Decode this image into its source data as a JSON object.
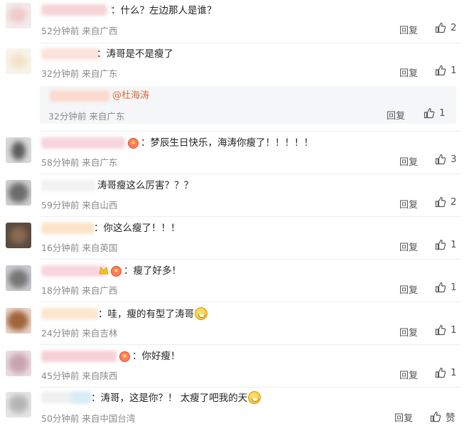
{
  "comments": [
    {
      "text": "：什么？左边那人是谁？",
      "time": "52分钟前",
      "location": "来自广西",
      "reply": "回复",
      "likes": "2"
    },
    {
      "text": "：涛哥是不是瘦了",
      "time": "32分钟前",
      "location": "来自广东",
      "reply": "回复",
      "likes": "1"
    },
    {
      "text": "：梦辰生日快乐，海涛你瘦了！！！！！",
      "time": "58分钟前",
      "location": "来自广东",
      "reply": "回复",
      "likes": "3"
    },
    {
      "text": "涛哥瘦这么厉害？？？",
      "time": "59分钟前",
      "location": "来自山西",
      "reply": "回复",
      "likes": "2"
    },
    {
      "text": "：你这么瘦了！！！",
      "time": "16分钟前",
      "location": "来自英国",
      "reply": "回复",
      "likes": "1"
    },
    {
      "text": "：瘦了好多！",
      "time": "18分钟前",
      "location": "来自广西",
      "reply": "回复",
      "likes": "1"
    },
    {
      "text": "：哇，瘦的有型了涛哥",
      "time": "24分钟前",
      "location": "来自吉林",
      "reply": "回复",
      "likes": "1"
    },
    {
      "text": "：你好瘦！",
      "time": "45分钟前",
      "location": "来自陕西",
      "reply": "回复",
      "likes": "1"
    },
    {
      "text": "：涛哥，这是你？！ 太瘦了吧我的天",
      "time": "50分钟前",
      "location": "来自中国台湾",
      "reply": "回复",
      "likes": "赞"
    }
  ],
  "subreply": {
    "mention": "@杜海涛",
    "time": "32分钟前",
    "location": "来自广东",
    "reply": "回复",
    "likes": "1"
  },
  "icons": {
    "like": "thumbs-up-icon",
    "emoji": "grinning-face-icon",
    "badge": "fan-badge-icon"
  }
}
